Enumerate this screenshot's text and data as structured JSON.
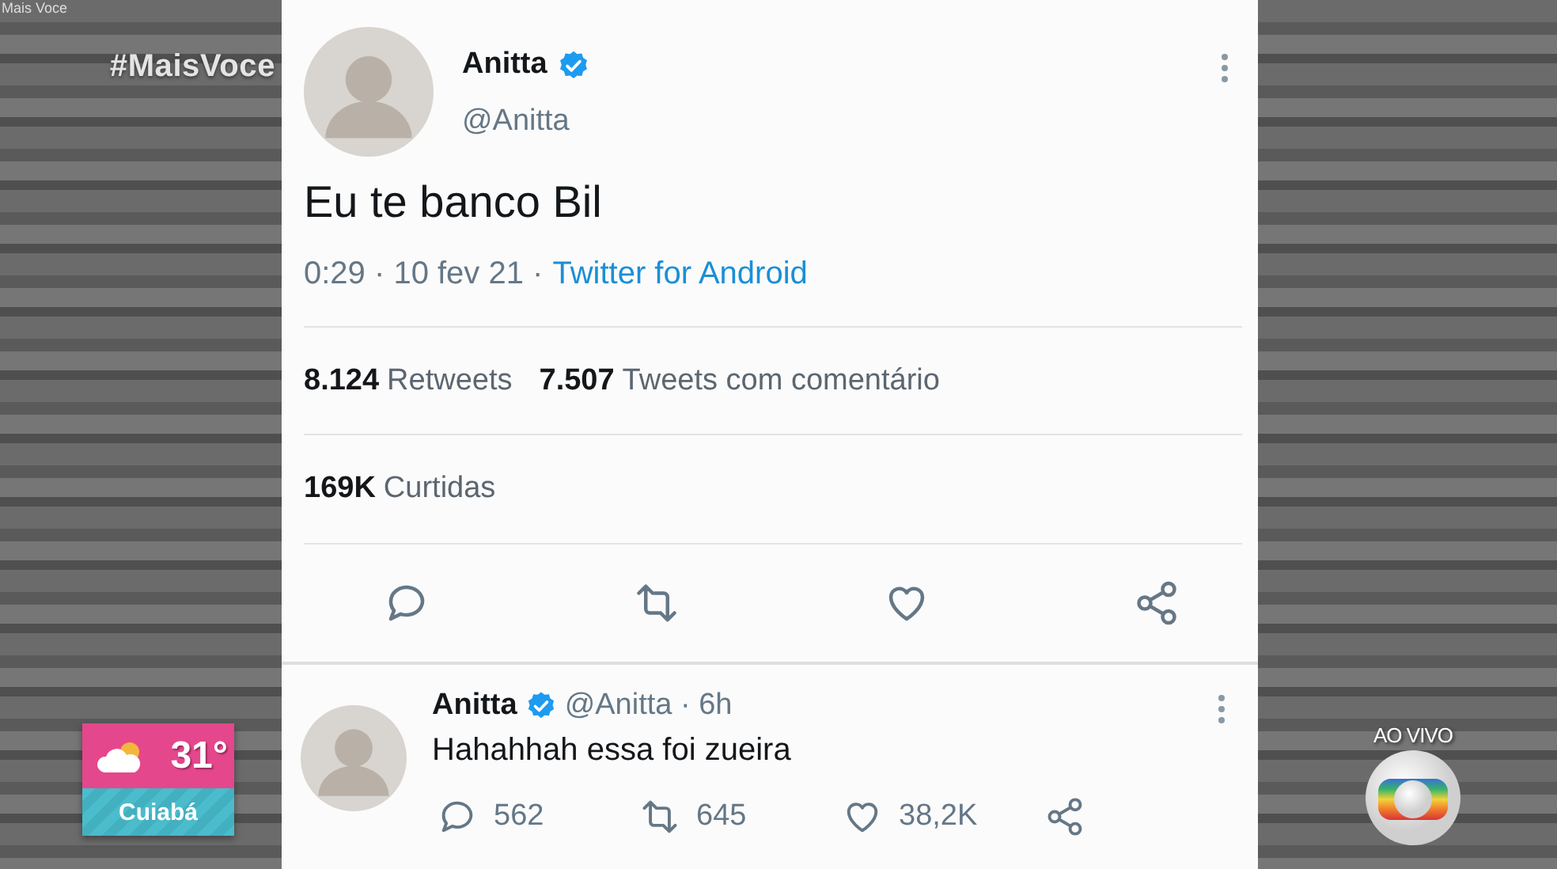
{
  "channel": {
    "caption": "Mais Voce",
    "hashtag": "#MaisVoce"
  },
  "weather": {
    "temperature": "31°",
    "city": "Cuiabá"
  },
  "live": {
    "label": "AO VIVO"
  },
  "tweet": {
    "name": "Anitta",
    "verified": true,
    "handle": "@Anitta",
    "text": "Eu te banco Bil",
    "timestamp": "0:29 · 10 fev 21 ·",
    "source": "Twitter for Android",
    "stats": [
      {
        "count": "8.124",
        "label": "Retweets"
      },
      {
        "count": "7.507",
        "label": "Tweets com comentário"
      }
    ],
    "likes": {
      "count": "169K",
      "label": "Curtidas"
    },
    "actions": [
      {
        "kind": "reply"
      },
      {
        "kind": "retweet"
      },
      {
        "kind": "like"
      },
      {
        "kind": "share"
      }
    ]
  },
  "reply": {
    "name": "Anitta",
    "verified": true,
    "handle": "@Anitta · 6h",
    "text": "Hahahhah essa foi zueira",
    "actions": [
      {
        "kind": "reply",
        "count": "562"
      },
      {
        "kind": "retweet",
        "count": "645"
      },
      {
        "kind": "like",
        "count": "38,2K"
      },
      {
        "kind": "share"
      }
    ]
  }
}
